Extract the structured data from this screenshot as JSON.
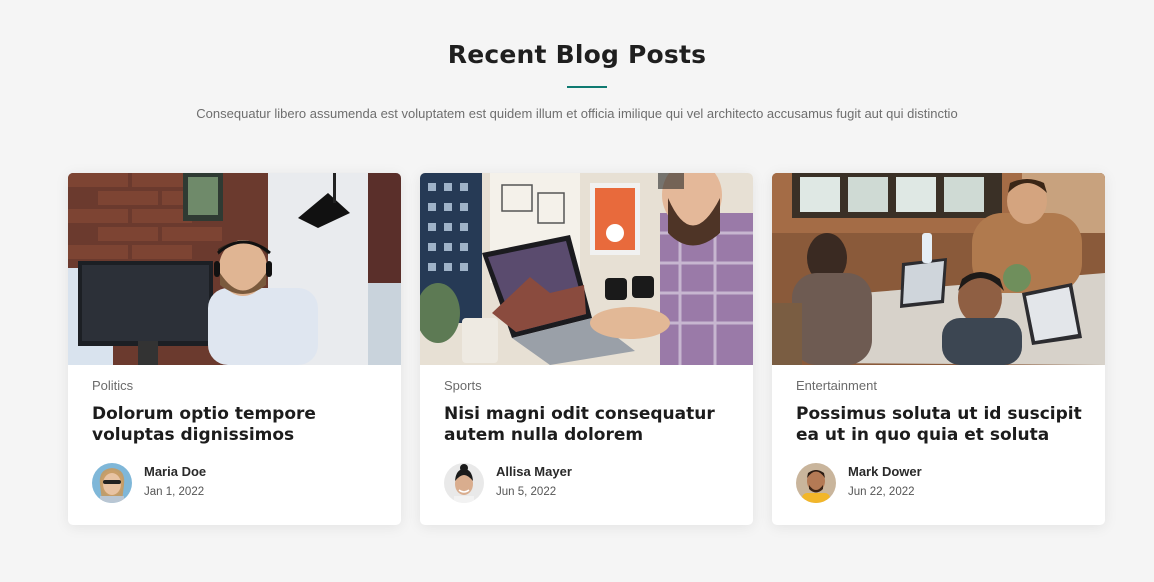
{
  "section": {
    "title": "Recent Blog Posts",
    "subtitle": "Consequatur libero assumenda est voluptatem est quidem illum et officia imilique qui vel architecto accusamus fugit aut qui distinctio",
    "accent_color": "#0f7a71"
  },
  "posts": [
    {
      "category": "Politics",
      "title": "Dolorum optio tempore voluptas dignissimos",
      "author": "Maria Doe",
      "date": "Jan 1, 2022"
    },
    {
      "category": "Sports",
      "title": "Nisi magni odit consequatur autem nulla dolorem",
      "author": "Allisa Mayer",
      "date": "Jun 5, 2022"
    },
    {
      "category": "Entertainment",
      "title": "Possimus soluta ut id suscipit ea ut in quo quia et soluta",
      "author": "Mark Dower",
      "date": "Jun 22, 2022"
    }
  ]
}
